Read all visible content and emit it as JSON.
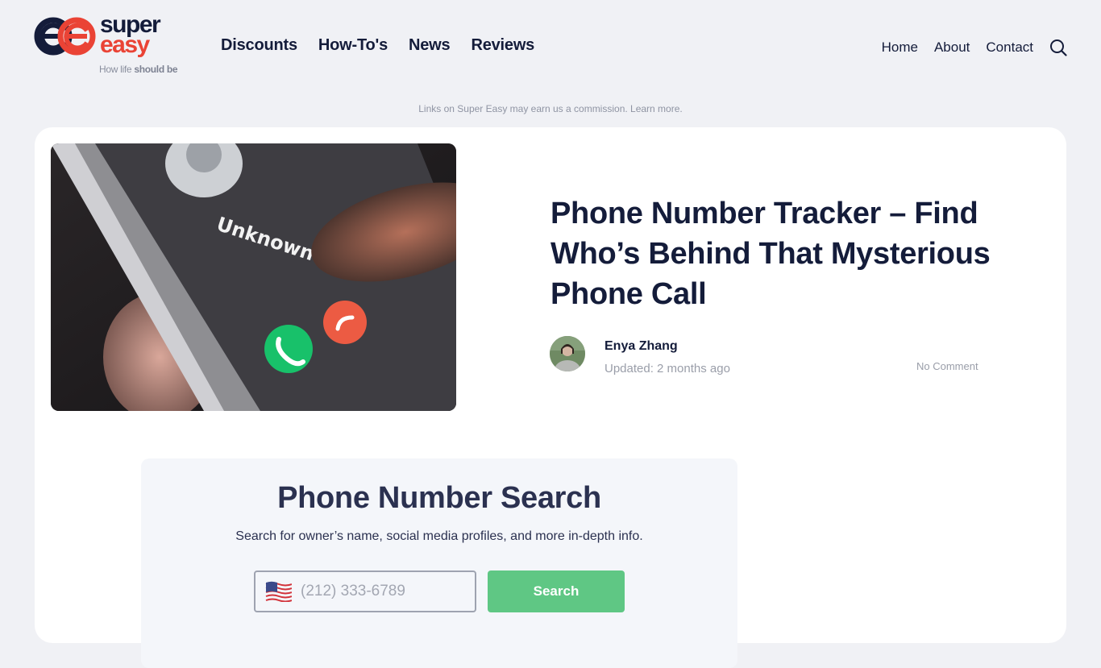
{
  "brand": {
    "name_line1": "super",
    "name_line2": "easy",
    "tagline_prefix": "How life ",
    "tagline_bold": "should be",
    "primary_color": "#141c3a",
    "accent_color": "#ea4335"
  },
  "main_nav": [
    {
      "label": "Discounts"
    },
    {
      "label": "How-To's"
    },
    {
      "label": "News"
    },
    {
      "label": "Reviews"
    }
  ],
  "secondary_nav": [
    {
      "label": "Home"
    },
    {
      "label": "About"
    },
    {
      "label": "Contact"
    }
  ],
  "search_icon": "search-icon",
  "disclaimer": {
    "text": "Links on Super Easy may earn us a commission. ",
    "link": "Learn more."
  },
  "article": {
    "hero_image_label": "Unknown",
    "hero_image_alt": "Phone showing incoming call from Unknown",
    "title": "Phone Number Tracker – Find Who’s Behind That Mysterious Phone Call",
    "author": "Enya Zhang",
    "updated": "Updated: 2 months ago",
    "comments": "No Comment"
  },
  "phone_search": {
    "title": "Phone Number Search",
    "subtitle": "Search for owner’s name, social media profiles, and more in-depth info.",
    "input_placeholder": "(212) 333-6789",
    "input_value": "",
    "flag_icon": "us-flag-icon",
    "button_label": "Search",
    "button_color": "#5fc784"
  }
}
